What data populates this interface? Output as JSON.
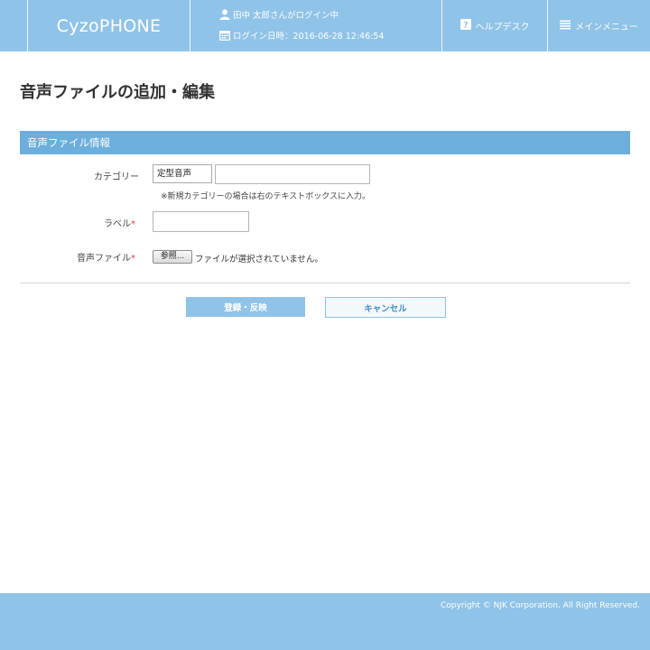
{
  "header": {
    "logo": "CyzoPHONE",
    "user_name": "田中 太郎さんがログイン中",
    "login_datetime": "ログイン日時：2016-06-28 12:46:54",
    "help_label": "ヘルプデスク",
    "menu_label": "メインメニュー",
    "icons": {
      "user": "user-icon",
      "calendar": "calendar-icon",
      "help": "question-icon",
      "menu": "hamburger-menu-icon"
    }
  },
  "page": {
    "title": "音声ファイルの追加・編集"
  },
  "section": {
    "title": "音声ファイル情報"
  },
  "form": {
    "category_label": "カテゴリー",
    "category_selected": "定型音声",
    "category_input_value": "",
    "category_note": "※新規カテゴリーの場合は右のテキストボックスに入力。",
    "label_label": "ラベル",
    "label_value": "",
    "audio_label": "音声ファイル",
    "required_mark": "*",
    "browse_label": "参照...",
    "file_status": "ファイルが選択されていません。"
  },
  "actions": {
    "submit_label": "登録・反映",
    "cancel_label": "キャンセル"
  },
  "footer": {
    "copyright": "Copyright © NJK Corporation. All Right Reserved."
  },
  "colors": {
    "header_bg": "#8fc3e7",
    "section_bar": "#6caedc",
    "required": "#e03c3c",
    "cancel_text": "#3f8dc4"
  }
}
